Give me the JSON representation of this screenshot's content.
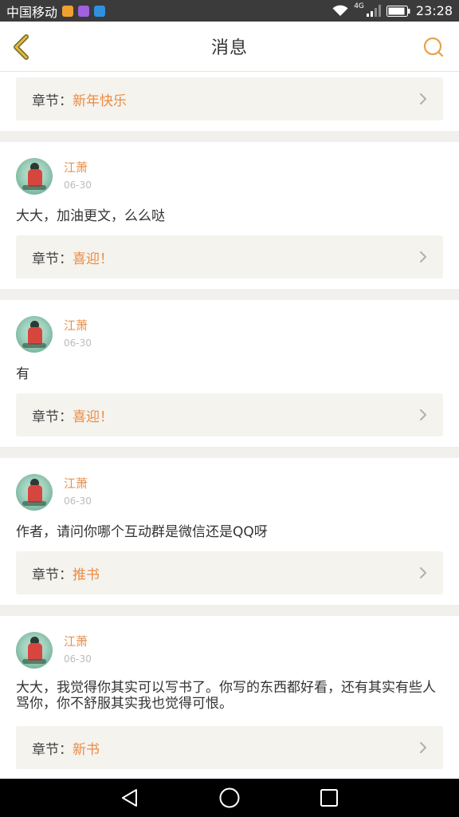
{
  "status_bar": {
    "carrier": "中国移动",
    "network": "4G",
    "time": "23:28",
    "badge_colors": [
      "#f0a030",
      "#a060e0",
      "#3090e0"
    ]
  },
  "header": {
    "title": "消息",
    "accent_color": "#e8a24a"
  },
  "chapter_prefix": "章节：",
  "messages": [
    {
      "chapter": "新年快乐"
    },
    {
      "user": "江萧",
      "date": "06-30",
      "text": "大大，加油更文，么么哒",
      "chapter": "喜迎！"
    },
    {
      "user": "江萧",
      "date": "06-30",
      "text": "有",
      "chapter": "喜迎！"
    },
    {
      "user": "江萧",
      "date": "06-30",
      "text": "作者，请问你哪个互动群是微信还是QQ呀",
      "chapter": "推书"
    },
    {
      "user": "江萧",
      "date": "06-30",
      "text": "大大，我觉得你其实可以写书了。你写的东西都好看，还有其实有些人骂你，你不舒服其实我也觉得可恨。",
      "chapter": "新书"
    }
  ],
  "nav_icons": [
    "back-triangle-icon",
    "home-circle-icon",
    "recents-square-icon"
  ]
}
